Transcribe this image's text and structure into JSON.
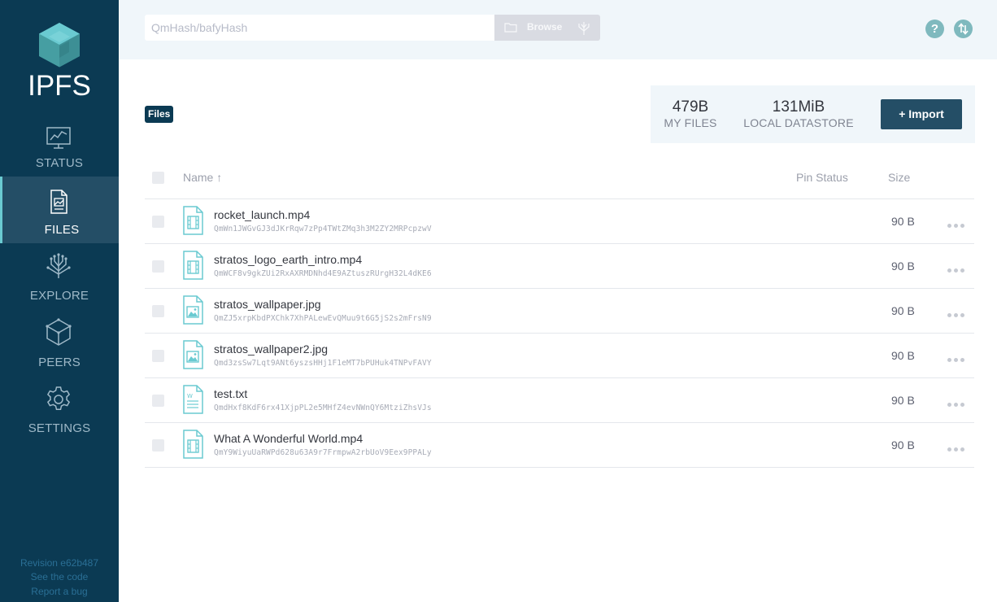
{
  "sidebar": {
    "logo_text": "IPFS",
    "items": [
      {
        "label": "STATUS",
        "icon": "status-monitor-icon"
      },
      {
        "label": "FILES",
        "icon": "files-document-icon",
        "active": true
      },
      {
        "label": "EXPLORE",
        "icon": "explore-tree-icon"
      },
      {
        "label": "PEERS",
        "icon": "peers-cube-icon"
      },
      {
        "label": "SETTINGS",
        "icon": "settings-gear-icon"
      }
    ],
    "footer": {
      "revision": "Revision e62b487",
      "see_code": "See the code",
      "report_bug": "Report a bug"
    }
  },
  "topbar": {
    "search_placeholder": "QmHash/bafyHash",
    "browse_label": "Browse",
    "help_label": "?"
  },
  "breadcrumb": "Files",
  "stats": {
    "my_files_value": "479B",
    "my_files_label": "MY FILES",
    "datastore_value": "131MiB",
    "datastore_label": "LOCAL DATASTORE",
    "import_label": "+ Import"
  },
  "table": {
    "headers": {
      "name": "Name ↑",
      "pin_status": "Pin Status",
      "size": "Size"
    },
    "rows": [
      {
        "name": "rocket_launch.mp4",
        "cid": "QmWn1JWGvGJ3dJKrRqw7zPp4TWtZMq3h3M2ZY2MRPcpzwV",
        "size": "90 B",
        "type": "video"
      },
      {
        "name": "stratos_logo_earth_intro.mp4",
        "cid": "QmWCF8v9gkZUi2RxAXRMDNhd4E9AZtuszRUrgH32L4dKE6",
        "size": "90 B",
        "type": "video"
      },
      {
        "name": "stratos_wallpaper.jpg",
        "cid": "QmZJ5xrpKbdPXChk7XhPALewEvQMuu9t6G5jS2s2mFrsN9",
        "size": "90 B",
        "type": "image"
      },
      {
        "name": "stratos_wallpaper2.jpg",
        "cid": "Qmd3zsSw7Lqt9ANt6yszsHHj1F1eMT7bPUHuk4TNPvFAVY",
        "size": "90 B",
        "type": "image"
      },
      {
        "name": "test.txt",
        "cid": "QmdHxf8KdF6rx41XjpPL2e5MHfZ4evNWnQY6MtziZhsVJs",
        "size": "90 B",
        "type": "text"
      },
      {
        "name": "What A Wonderful World.mp4",
        "cid": "QmY9WiyuUaRWPd628u63A9r7FrmpwA2rbUoV9Eex9PPALy",
        "size": "90 B",
        "type": "video"
      }
    ]
  },
  "colors": {
    "sidebar_bg": "#0b3a53",
    "sidebar_active": "#244e66",
    "accent_teal": "#6acad1",
    "topbar_bg": "#f0f6fa"
  }
}
